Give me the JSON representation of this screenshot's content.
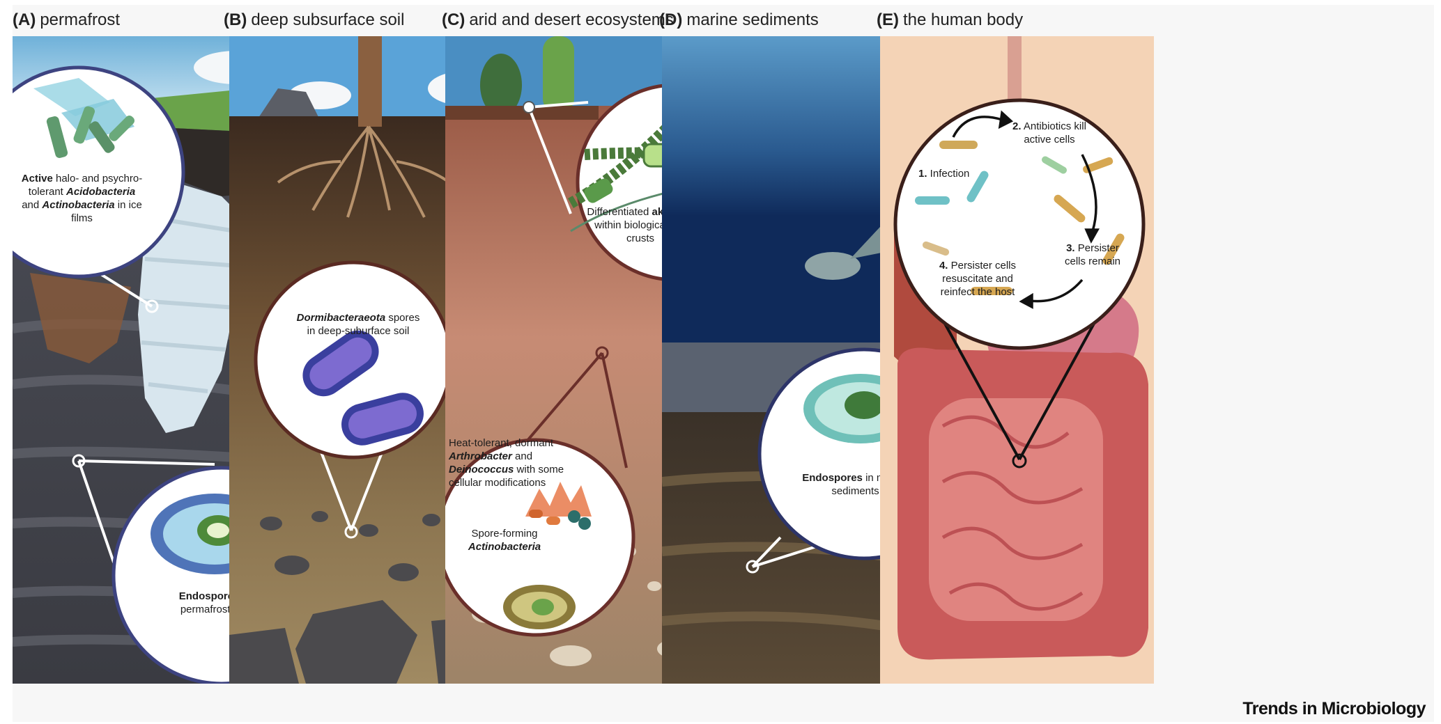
{
  "panels": {
    "a": {
      "tag": "(A)",
      "title": "permafrost",
      "callout1": {
        "bold1": "Active",
        "t1": " halo- and psychro-tolerant ",
        "it1": "Acidobacteria",
        "t2": " and ",
        "it2": "Actinobacteria",
        "t3": " in ice films"
      },
      "callout2": {
        "bold": "Endospores",
        "t1": " in permafrost soil"
      }
    },
    "b": {
      "tag": "(B)",
      "title": "deep subsurface soil",
      "callout1": {
        "it": "Dormibacteraeota",
        "t1": " spores in deep-suburface soil"
      }
    },
    "c": {
      "tag": "(C)",
      "title": "arid and desert ecosystems",
      "callout1": {
        "t1": "Differentiated ",
        "bold": "akinetes",
        "t2": " within biological soil crusts"
      },
      "callout2": {
        "t1": "Heat-tolerant, dormant ",
        "it1": "Arthrobacter",
        "t2": " and ",
        "it2": "Deinococcus",
        "t3": " with some cellular modifications"
      },
      "callout3": {
        "t1": "Spore-forming ",
        "it": "Actinobacteria"
      }
    },
    "d": {
      "tag": "(D)",
      "title": "marine sediments",
      "callout1": {
        "bold": "Endospores",
        "t1": " in marine sediments"
      }
    },
    "e": {
      "tag": "(E)",
      "title": "the human body",
      "step1": {
        "num": "1.",
        "text": " Infection"
      },
      "step2": {
        "num": "2.",
        "text": " Antibiotics kill active cells"
      },
      "step3": {
        "num": "3.",
        "text": " Persister cells remain"
      },
      "step4": {
        "num": "4.",
        "text": " Persister cells resuscitate and reinfect the host"
      }
    }
  },
  "footer": "Trends in Microbiology"
}
